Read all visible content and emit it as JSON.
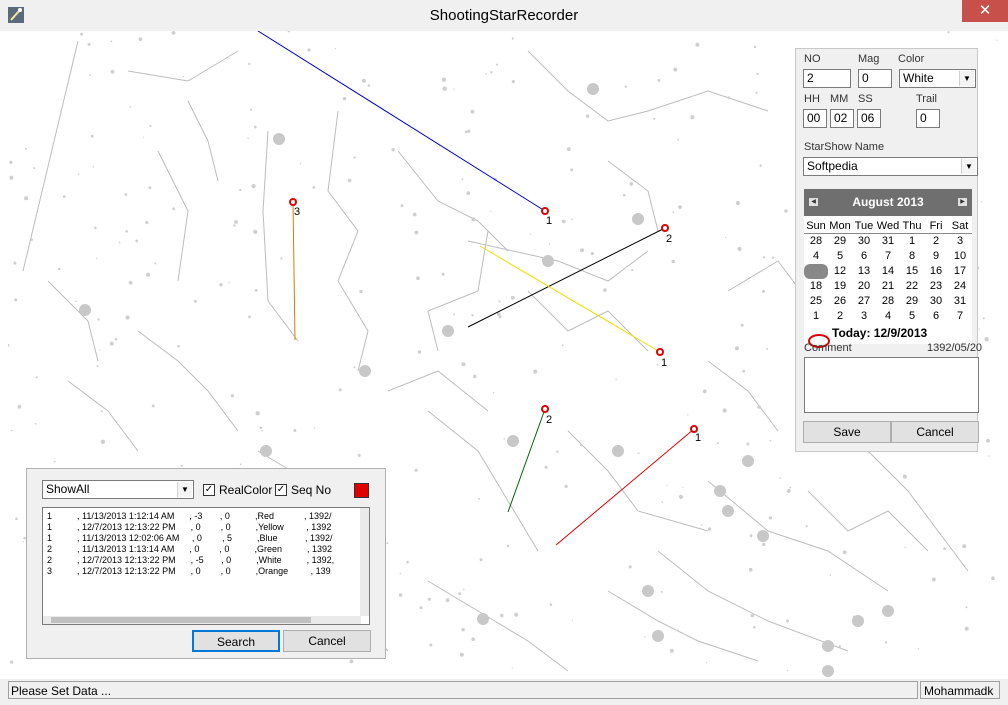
{
  "window": {
    "title": "ShootingStarRecorder",
    "close_glyph": "✕",
    "icon": "app-icon"
  },
  "entry": {
    "no_label": "NO",
    "no_value": "2",
    "mag_label": "Mag",
    "mag_value": "0",
    "color_label": "Color",
    "color_value": "White",
    "hh_label": "HH",
    "hh_value": "00",
    "mm_label": "MM",
    "mm_value": "02",
    "ss_label": "SS",
    "ss_value": "06",
    "trail_label": "Trail",
    "trail_value": "0",
    "starshow_label": "StarShow Name",
    "starshow_value": "Softpedia",
    "comment_label": "Comment",
    "persian_date": "1392/05/20",
    "save_label": "Save",
    "cancel_label": "Cancel"
  },
  "calendar": {
    "month_title": "August 2013",
    "days_of_week": [
      "Sun",
      "Mon",
      "Tue",
      "Wed",
      "Thu",
      "Fri",
      "Sat"
    ],
    "weeks": [
      [
        "28",
        "29",
        "30",
        "31",
        "1",
        "2",
        "3"
      ],
      [
        "4",
        "5",
        "6",
        "7",
        "8",
        "9",
        "10"
      ],
      [
        "11",
        "12",
        "13",
        "14",
        "15",
        "16",
        "17"
      ],
      [
        "18",
        "19",
        "20",
        "21",
        "22",
        "23",
        "24"
      ],
      [
        "25",
        "26",
        "27",
        "28",
        "29",
        "30",
        "31"
      ],
      [
        "1",
        "2",
        "3",
        "4",
        "5",
        "6",
        "7"
      ]
    ],
    "selected_day": "11",
    "today_label": "Today: 12/9/2013"
  },
  "search": {
    "filter_value": "ShowAll",
    "realcolor_label": "RealColor",
    "realcolor_checked": true,
    "seqno_label": "Seq No",
    "seqno_checked": true,
    "selected_color": "#e00000",
    "rows": [
      "1          , 11/13/2013 1:12:14 AM      , -3       , 0          ,Red            , 1392/",
      "1          , 12/7/2013 12:13:22 PM      , 0        , 0          ,Yellow         , 1392",
      "1          , 11/13/2013 12:02:06 AM     , 0        , 5          ,Blue           , 1392/",
      "2          , 11/13/2013 1:13:14 AM      , 0        , 0          ,Green          , 1392",
      "2          , 12/7/2013 12:13:22 PM      , -5       , 0          ,White          , 1392,",
      "3          , 12/7/2013 12:13:22 PM      , 0        , 0          ,Orange         , 139"
    ],
    "search_label": "Search",
    "cancel_label": "Cancel"
  },
  "meteors": [
    {
      "label": "1",
      "color": "#0000cc"
    },
    {
      "label": "2",
      "color": "#000000"
    },
    {
      "label": "1",
      "color": "#f0e000"
    },
    {
      "label": "3",
      "color": "#d08000"
    },
    {
      "label": "2",
      "color": "#006600"
    },
    {
      "label": "1",
      "color": "#dd0000"
    }
  ],
  "status": {
    "message": "Please Set Data ...",
    "user": "Mohammadk"
  }
}
